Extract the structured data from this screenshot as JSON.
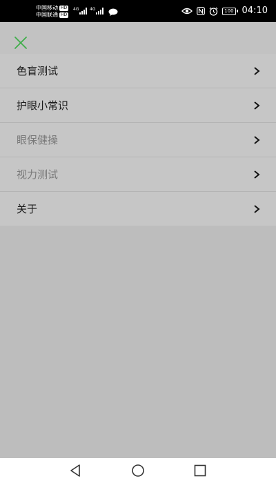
{
  "status_bar": {
    "carrier_1": "中国移动",
    "carrier_2": "中国联通",
    "hd_label": "HD",
    "network_1": "4G",
    "network_2": "4G",
    "battery_level": "100",
    "time": "04:10",
    "icons": [
      "message-icon",
      "eye-icon",
      "nfc-icon",
      "alarm-icon"
    ]
  },
  "header": {
    "close_icon": "close-icon",
    "close_color": "#3fae49"
  },
  "menu": {
    "items": [
      {
        "label": "色盲测试",
        "enabled": true
      },
      {
        "label": "护眼小常识",
        "enabled": true
      },
      {
        "label": "眼保健操",
        "enabled": false
      },
      {
        "label": "视力测试",
        "enabled": false
      },
      {
        "label": "关于",
        "enabled": true
      }
    ],
    "chevron_icon": "chevron-right-icon"
  },
  "nav_bar": {
    "icons": [
      "back-icon",
      "home-icon",
      "recents-icon"
    ]
  }
}
